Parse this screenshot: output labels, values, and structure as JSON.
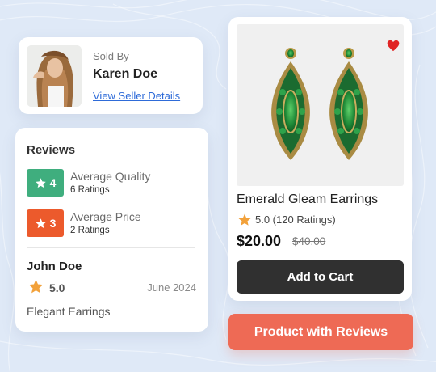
{
  "colors": {
    "accent_green": "#3fae7e",
    "accent_orange": "#ec5a2c",
    "star": "#f2a13a",
    "heart": "#e02424",
    "cta_dark": "#303030",
    "tag": "#ee6a55"
  },
  "seller": {
    "sold_by_label": "Sold By",
    "name": "Karen Doe",
    "link_label": "View Seller Details"
  },
  "reviews": {
    "title": "Reviews",
    "metrics": [
      {
        "score": "4",
        "label": "Average Quality",
        "count": "6 Ratings",
        "color": "#3fae7e",
        "icon": "star-icon"
      },
      {
        "score": "3",
        "label": "Average Price",
        "count": "2 Ratings",
        "color": "#ec5a2c",
        "icon": "star-icon"
      }
    ],
    "latest": {
      "reviewer": "John Doe",
      "rating": "5.0",
      "date": "June 2024",
      "text": "Elegant Earrings"
    }
  },
  "product": {
    "name": "Emerald Gleam Earrings",
    "rating_text": "5.0 (120 Ratings)",
    "price": "$20.00",
    "old_price": "$40.00",
    "cta_label": "Add to Cart",
    "favorite": true
  },
  "tag_label": "Product with Reviews"
}
